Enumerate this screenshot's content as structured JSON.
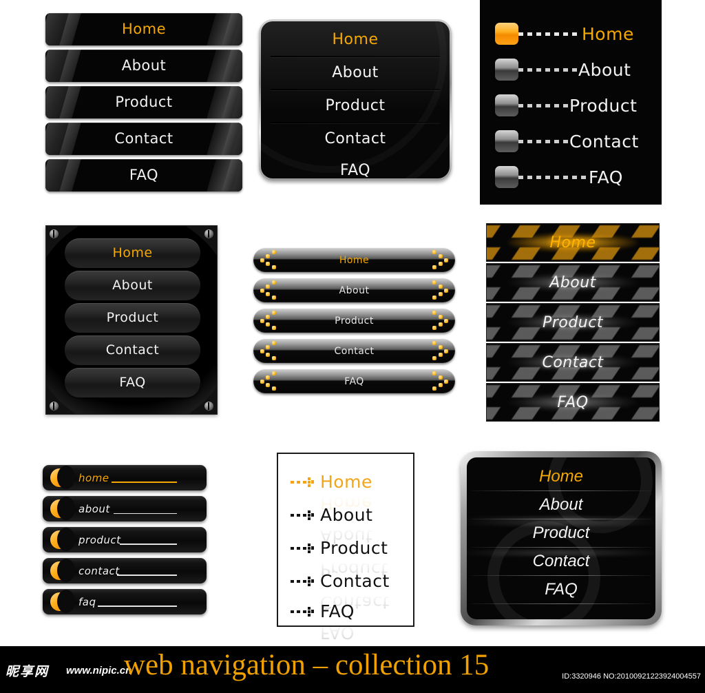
{
  "page": {
    "title": "web navigation - collection 15",
    "background": "#ffffff",
    "accent_orange": "#f5a800",
    "text_white": "#f2f2f2"
  },
  "items": [
    "Home",
    "About",
    "Product",
    "Contact",
    "FAQ"
  ],
  "items_lower": [
    "home",
    "about",
    "product",
    "contact",
    "faq"
  ],
  "menus": [
    {
      "id": "menu1",
      "name": "glossy-bar-menu",
      "items": [
        {
          "label": "Home",
          "state": "active"
        },
        {
          "label": "About",
          "state": "normal"
        },
        {
          "label": "Product",
          "state": "normal"
        },
        {
          "label": "Contact",
          "state": "normal"
        },
        {
          "label": "FAQ",
          "state": "normal"
        }
      ]
    },
    {
      "id": "menu2",
      "name": "rounded-panel-menu",
      "items": [
        {
          "label": "Home",
          "state": "active"
        },
        {
          "label": "About",
          "state": "normal"
        },
        {
          "label": "Product",
          "state": "normal"
        },
        {
          "label": "Contact",
          "state": "normal"
        },
        {
          "label": "FAQ",
          "state": "normal"
        }
      ]
    },
    {
      "id": "menu3",
      "name": "dashed-chip-menu",
      "items": [
        {
          "label": "Home",
          "state": "active"
        },
        {
          "label": "About",
          "state": "normal"
        },
        {
          "label": "Product",
          "state": "normal"
        },
        {
          "label": "Contact",
          "state": "normal"
        },
        {
          "label": "FAQ",
          "state": "normal"
        }
      ]
    },
    {
      "id": "menu4",
      "name": "pill-panel-menu",
      "items": [
        {
          "label": "Home",
          "state": "active"
        },
        {
          "label": "About",
          "state": "normal"
        },
        {
          "label": "Product",
          "state": "normal"
        },
        {
          "label": "Contact",
          "state": "normal"
        },
        {
          "label": "FAQ",
          "state": "normal"
        }
      ]
    },
    {
      "id": "menu5",
      "name": "chevron-dots-menu",
      "items": [
        {
          "label": "Home",
          "state": "active"
        },
        {
          "label": "About",
          "state": "normal"
        },
        {
          "label": "Product",
          "state": "normal"
        },
        {
          "label": "Contact",
          "state": "normal"
        },
        {
          "label": "FAQ",
          "state": "normal"
        }
      ]
    },
    {
      "id": "menu6",
      "name": "striped-glow-menu",
      "items": [
        {
          "label": "Home",
          "state": "active"
        },
        {
          "label": "About",
          "state": "normal"
        },
        {
          "label": "Product",
          "state": "normal"
        },
        {
          "label": "Contact",
          "state": "normal"
        },
        {
          "label": "FAQ",
          "state": "normal"
        }
      ]
    },
    {
      "id": "menu7",
      "name": "crescent-underline-menu",
      "items": [
        {
          "label": "home",
          "state": "active"
        },
        {
          "label": "about",
          "state": "normal"
        },
        {
          "label": "product",
          "state": "normal"
        },
        {
          "label": "contact",
          "state": "normal"
        },
        {
          "label": "faq",
          "state": "normal"
        }
      ]
    },
    {
      "id": "menu8",
      "name": "white-arrow-menu",
      "items": [
        {
          "label": "Home",
          "state": "active"
        },
        {
          "label": "About",
          "state": "normal"
        },
        {
          "label": "Product",
          "state": "normal"
        },
        {
          "label": "Contact",
          "state": "normal"
        },
        {
          "label": "FAQ",
          "state": "normal"
        }
      ]
    },
    {
      "id": "menu9",
      "name": "metal-frame-menu",
      "items": [
        {
          "label": "Home",
          "state": "active"
        },
        {
          "label": "About",
          "state": "normal"
        },
        {
          "label": "Product",
          "state": "normal"
        },
        {
          "label": "Contact",
          "state": "normal"
        },
        {
          "label": "FAQ",
          "state": "normal"
        }
      ]
    }
  ],
  "footer": {
    "site_name_cn": "昵享网",
    "site_url": "www.nipic.cn",
    "title": "web navigation – collection 15",
    "id_text": "ID:3320946 NO:20100921223924004557"
  }
}
